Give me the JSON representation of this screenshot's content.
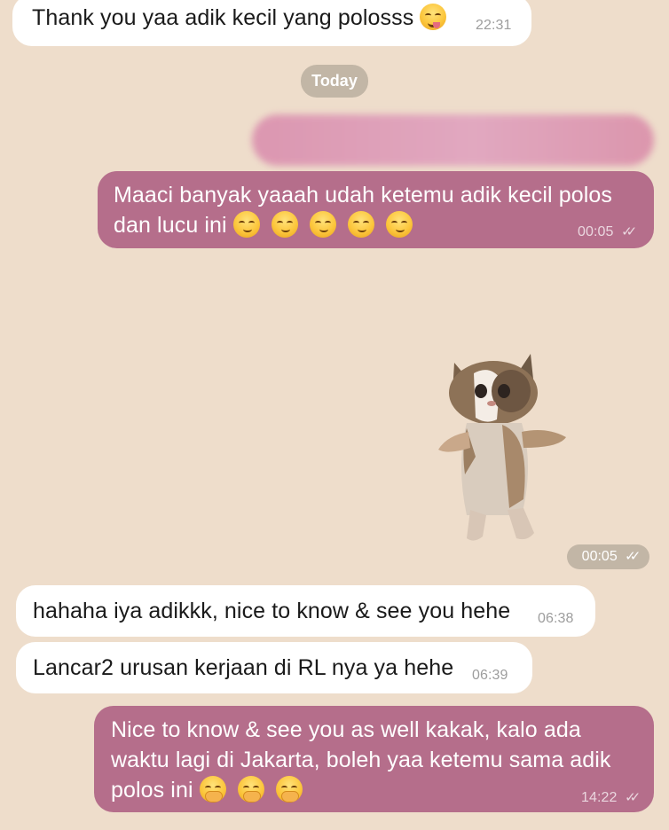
{
  "chat": {
    "background_color": "#eeddcb",
    "date_separator": "Today",
    "messages": [
      {
        "id": "msg-1",
        "direction": "incoming",
        "text": "Thank you yaa adik kecil yang polosss",
        "emojis": [
          "zany-face"
        ],
        "time": "22:31"
      },
      {
        "id": "msg-2",
        "direction": "outgoing",
        "text": "[blurred message]",
        "blurred": true
      },
      {
        "id": "msg-3",
        "direction": "outgoing",
        "text_line1": "Maaci banyak yaaah udah ketemu adik kecil polos",
        "text_line2": "dan lucu ini",
        "emojis": [
          "smirking-face",
          "smirking-face",
          "smirking-face",
          "smirking-face",
          "smirking-face"
        ],
        "time": "00:05",
        "status": "read"
      },
      {
        "id": "msg-4",
        "direction": "outgoing",
        "type": "sticker",
        "sticker": "dancing-cat",
        "time": "00:05",
        "status": "read"
      },
      {
        "id": "msg-5",
        "direction": "incoming",
        "text": "hahaha iya adikkk, nice to know & see you hehe",
        "time": "06:38"
      },
      {
        "id": "msg-6",
        "direction": "incoming",
        "text": "Lancar2 urusan kerjaan di RL nya ya hehe",
        "time": "06:39"
      },
      {
        "id": "msg-7",
        "direction": "outgoing",
        "text_line1": "Nice to know & see you as well kakak, kalo ada",
        "text_line2": "waktu lagi di Jakarta, boleh yaa ketemu sama adik",
        "text_line3": "polos ini",
        "emojis": [
          "face-with-hand-over-mouth",
          "face-with-hand-over-mouth",
          "face-with-hand-over-mouth"
        ],
        "time": "14:22",
        "status": "read"
      }
    ],
    "colors": {
      "incoming_bubble": "#ffffff",
      "outgoing_bubble": "#b56e8b",
      "date_chip": "#c2b6a6"
    }
  }
}
